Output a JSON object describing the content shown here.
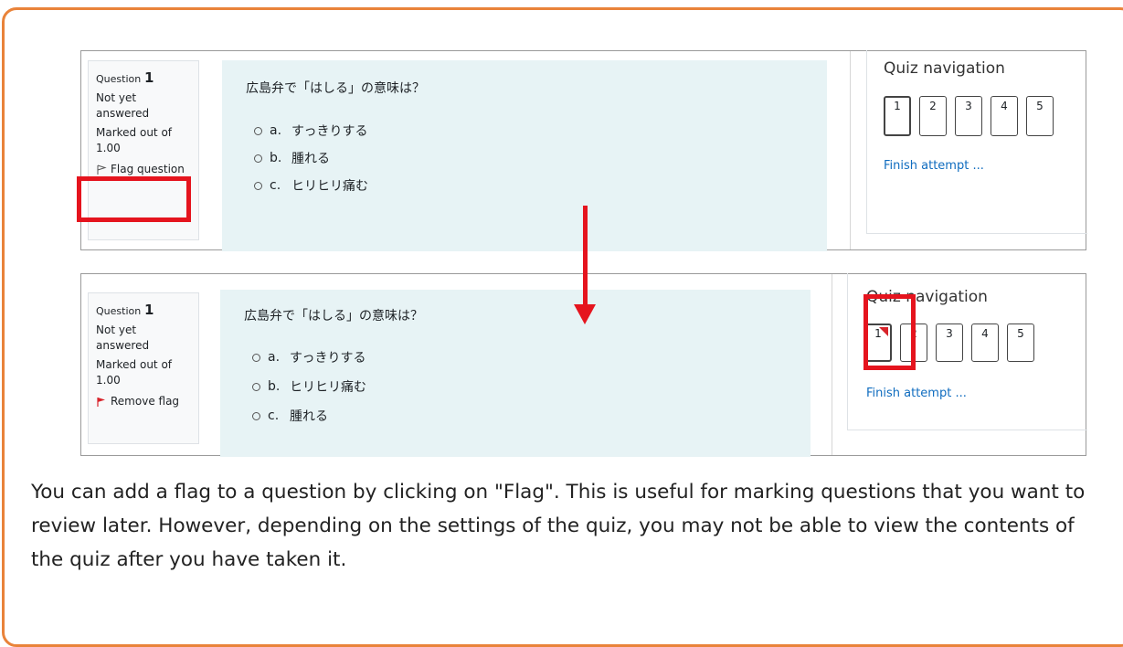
{
  "top_screenshot": {
    "info": {
      "question_label": "Question",
      "question_number": "1",
      "state": "Not yet answered",
      "marks": "Marked out of 1.00",
      "flag_label": "Flag question"
    },
    "question_text": "広島弁で「はしる」の意味は？",
    "answers": [
      {
        "letter": "a.",
        "text": "すっきりする"
      },
      {
        "letter": "b.",
        "text": "腫れる"
      },
      {
        "letter": "c.",
        "text": "ヒリヒリ痛む"
      }
    ],
    "nav": {
      "title": "Quiz navigation",
      "buttons": [
        "1",
        "2",
        "3",
        "4",
        "5"
      ],
      "finish": "Finish attempt ..."
    }
  },
  "bottom_screenshot": {
    "info": {
      "question_label": "Question",
      "question_number": "1",
      "state": "Not yet answered",
      "marks": "Marked out of 1.00",
      "flag_label": "Remove flag"
    },
    "question_text": "広島弁で「はしる」の意味は？",
    "answers": [
      {
        "letter": "a.",
        "text": "すっきりする"
      },
      {
        "letter": "b.",
        "text": "ヒリヒリ痛む"
      },
      {
        "letter": "c.",
        "text": "腫れる"
      }
    ],
    "nav": {
      "title": "Quiz navigation",
      "buttons": [
        "1",
        "2",
        "3",
        "4",
        "5"
      ],
      "finish": "Finish attempt ..."
    }
  },
  "caption": " You can add a flag to a question by clicking on \"Flag\". This is useful for marking questions that you want to review later. However, depending on the settings of the quiz, you may not be able to view the contents of the quiz after you have taken it.",
  "colors": {
    "frame": "#e9833a",
    "highlight": "#e5141e",
    "link": "#0f6cbf",
    "question_bg": "#e7f3f5"
  }
}
